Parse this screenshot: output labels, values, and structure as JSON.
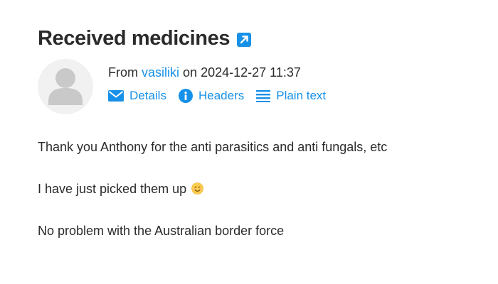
{
  "subject": {
    "title": "Received medicines",
    "open_icon": "external-link-icon"
  },
  "sender": {
    "avatar_icon": "user-silhouette-icon",
    "from_prefix": "From",
    "name": "vasiliki",
    "date_prefix": "on",
    "datetime": "2024-12-27 11:37"
  },
  "actions": {
    "details_label": "Details",
    "details_icon": "envelope-icon",
    "headers_label": "Headers",
    "headers_icon": "info-icon",
    "plain_text_label": "Plain text",
    "plain_text_icon": "lines-icon"
  },
  "message": {
    "line1": "Thank you Anthony for the anti parasitics and anti fungals, etc",
    "line2": "I have just picked them up",
    "line2_emoji": "smiling-face-emoji",
    "line3": "No problem with the Australian border force"
  },
  "colors": {
    "link": "#1791e8",
    "text": "#2b2b2b",
    "avatar_bg": "#f1f1f1",
    "avatar_fg": "#c9c9c9"
  }
}
